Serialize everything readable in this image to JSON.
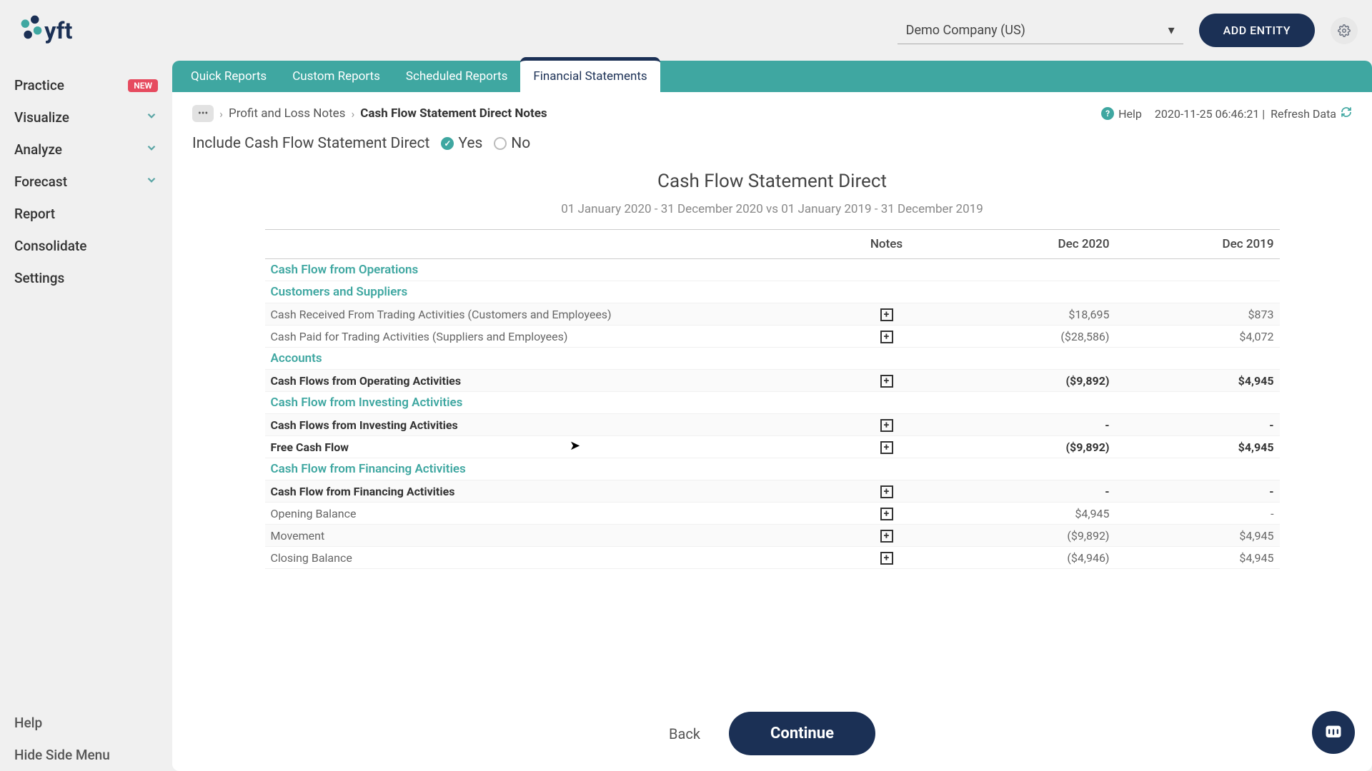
{
  "header": {
    "entity_name": "Demo Company (US)",
    "add_entity_label": "ADD ENTITY"
  },
  "sidebar": {
    "items": [
      {
        "label": "Practice",
        "badge": "NEW",
        "expandable": false
      },
      {
        "label": "Visualize",
        "expandable": true
      },
      {
        "label": "Analyze",
        "expandable": true
      },
      {
        "label": "Forecast",
        "expandable": true
      },
      {
        "label": "Report",
        "expandable": false
      },
      {
        "label": "Consolidate",
        "expandable": false
      },
      {
        "label": "Settings",
        "expandable": false
      }
    ],
    "help_label": "Help",
    "hide_label": "Hide Side Menu"
  },
  "tabs": [
    {
      "label": "Quick Reports",
      "active": false
    },
    {
      "label": "Custom Reports",
      "active": false
    },
    {
      "label": "Scheduled Reports",
      "active": false
    },
    {
      "label": "Financial Statements",
      "active": true
    }
  ],
  "breadcrumb": {
    "parent": "Profit and Loss Notes",
    "current": "Cash Flow Statement Direct Notes"
  },
  "toolbar": {
    "help_label": "Help",
    "timestamp": "2020-11-25 06:46:21",
    "refresh_label": "Refresh Data"
  },
  "include": {
    "label": "Include Cash Flow Statement Direct",
    "yes": "Yes",
    "no": "No"
  },
  "report": {
    "title": "Cash Flow Statement Direct",
    "subtitle": "01 January 2020 - 31 December 2020 vs 01 January 2019 - 31 December 2019",
    "columns": {
      "notes": "Notes",
      "p1": "Dec 2020",
      "p2": "Dec 2019"
    },
    "rows": [
      {
        "type": "section",
        "label": "Cash Flow from Operations"
      },
      {
        "type": "section",
        "label": "Customers and Suppliers"
      },
      {
        "type": "line",
        "label": "Cash Received From Trading Activities (Customers and Employees)",
        "note": true,
        "p1": "$18,695",
        "p2": "$873",
        "stripe": true
      },
      {
        "type": "line",
        "label": "Cash Paid for Trading Activities (Suppliers and Employees)",
        "note": true,
        "p1": "($28,586)",
        "p2": "$4,072"
      },
      {
        "type": "section",
        "label": "Accounts"
      },
      {
        "type": "bold",
        "label": "Cash Flows from Operating Activities",
        "note": true,
        "p1": "($9,892)",
        "p2": "$4,945",
        "stripe": true
      },
      {
        "type": "section",
        "label": "Cash Flow from Investing Activities"
      },
      {
        "type": "bold",
        "label": "Cash Flows from Investing Activities",
        "note": true,
        "p1": "-",
        "p2": "-",
        "stripe": true
      },
      {
        "type": "bold",
        "label": "Free Cash Flow",
        "note": true,
        "p1": "($9,892)",
        "p2": "$4,945"
      },
      {
        "type": "section",
        "label": "Cash Flow from Financing Activities"
      },
      {
        "type": "bold",
        "label": "Cash Flow from Financing Activities",
        "note": true,
        "p1": "-",
        "p2": "-",
        "stripe": true
      },
      {
        "type": "line",
        "label": "Opening Balance",
        "note": true,
        "p1": "$4,945",
        "p2": "-"
      },
      {
        "type": "line",
        "label": "Movement",
        "note": true,
        "p1": "($9,892)",
        "p2": "$4,945",
        "stripe": true
      },
      {
        "type": "line",
        "label": "Closing Balance",
        "note": true,
        "p1": "($4,946)",
        "p2": "$4,945"
      }
    ]
  },
  "actions": {
    "back": "Back",
    "continue": "Continue"
  }
}
